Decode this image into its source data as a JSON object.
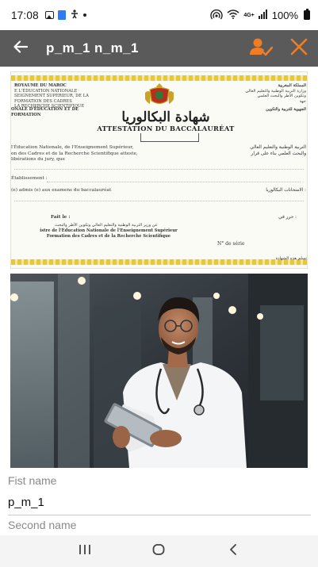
{
  "status_bar": {
    "time": "17:08",
    "battery_text": "100%",
    "network_label": "4G+",
    "icons": [
      "image-icon",
      "app-icon",
      "accessibility-icon",
      "dot-icon",
      "hotspot-icon",
      "wifi-icon",
      "signal-icon",
      "battery-icon"
    ]
  },
  "app_bar": {
    "title": "p_m_1 n_m_1",
    "background": "#5a5a5a",
    "accent": "#f07c23",
    "icons": [
      "back-arrow-icon",
      "user-check-icon",
      "close-icon"
    ]
  },
  "document": {
    "title_ar": "شهادة البكالوريا",
    "title_fr": "ATTESTATION DU BACCALAURÉAT",
    "header_left": [
      "ROYAUME DU MAROC",
      "E L'ÉDUCATION NATIONALE",
      "SEIGNEMENT SUPÉRIEUR, DE LA FORMATION DES CADRES",
      "LA RECHERCHE SCIENTIFIQUE"
    ],
    "header_left_bottom": "ONALE D'ÉDUCATION ET DE FORMATION",
    "header_right": [
      "المملكة المغربية",
      "وزارة التربية الوطنية والتعليم العالي",
      "وتكوين الأطر والبحث العلمي",
      "جهة"
    ],
    "header_right_bottom": "الجهوية للتربية والتكوين",
    "body_left": [
      "l'Éducation Nationale, de l'Enseignement Supérieur,",
      "on des Cadres et de la Recherche Scientifique atteste,",
      "libérations du jury, que"
    ],
    "body_right": [
      "التربية الوطنية والتعليم العالي",
      "والبحث العلمي بناء على قرار"
    ],
    "etablissement_label": "Établissement :",
    "admis_label": "(e) admis (e) aux examens du baccalauréat",
    "admis_ar": "الامتحانات البكالوريا :",
    "fait_le": "Fait le :",
    "fait_ar": "حرر في :",
    "signature_fr": [
      "istre de l'Éducation Nationale de l'Enseignement Supérieur",
      "Formation des Cadres et de la Recherche Scientifique"
    ],
    "signature_ar": "عن وزير التربية الوطنية والتعليم العالي وتكوين الأطر والبحث",
    "serie_label": "N° de série",
    "footer_ar": "تسلم هذه الشهادة"
  },
  "form": {
    "first_name_label": "Fist name",
    "first_name_value": "p_m_1",
    "second_name_label": "Second name"
  },
  "nav_bar": {
    "icons": [
      "recents-icon",
      "home-icon",
      "back-icon"
    ]
  }
}
